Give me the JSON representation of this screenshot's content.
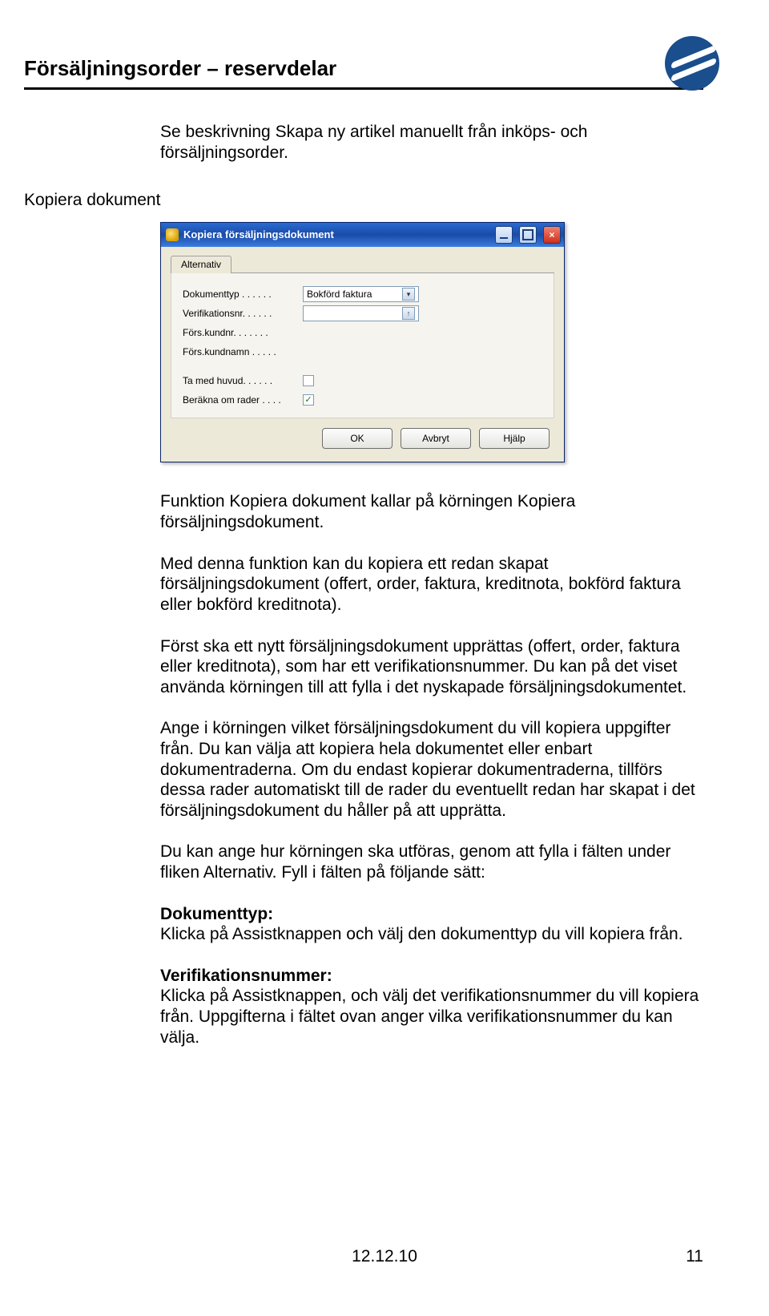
{
  "header": {
    "title": "Försäljningsorder – reservdelar"
  },
  "logo": {
    "name": "company-logo"
  },
  "intro": "Se beskrivning Skapa ny artikel manuellt från inköps- och försäljningsorder.",
  "section_label": "Kopiera dokument",
  "dialog": {
    "title": "Kopiera försäljningsdokument",
    "tab": "Alternativ",
    "fields": {
      "dokumenttyp_label": "Dokumenttyp . . . . . .",
      "dokumenttyp_value": "Bokförd faktura",
      "verifikationsnr_label": "Verifikationsnr. . . . . .",
      "verifikationsnr_value": "",
      "forskundnr_label": "Förs.kundnr. . . . . . .",
      "forskundnamn_label": "Förs.kundnamn . . . . .",
      "tamedhuvud_label": "Ta med huvud. . . . . .",
      "tamedhuvud_checked": false,
      "beraknaom_label": "Beräkna om rader . . . .",
      "beraknaom_checked": true
    },
    "buttons": {
      "ok": "OK",
      "cancel": "Avbryt",
      "help": "Hjälp"
    }
  },
  "body": {
    "p1": "Funktion Kopiera dokument kallar på körningen Kopiera försäljningsdokument.",
    "p2": "Med denna funktion kan du kopiera ett redan skapat försäljningsdokument (offert, order, faktura, kreditnota, bokförd faktura eller bokförd kreditnota).",
    "p3": "Först ska ett nytt försäljningsdokument upprättas (offert, order, faktura eller kreditnota), som har ett verifikationsnummer. Du kan på det viset använda körningen till att fylla i det nyskapade försäljningsdokumentet.",
    "p4": "Ange i körningen vilket försäljningsdokument du vill kopiera uppgifter från. Du kan välja att kopiera hela dokumentet eller enbart dokumentraderna. Om du endast kopierar dokumentraderna, tillförs dessa rader automatiskt till de rader du eventuellt redan har skapat i det försäljningsdokument du håller på att upprätta.",
    "p5": "Du kan ange hur körningen ska utföras, genom att fylla i fälten under fliken Alternativ. Fyll i fälten på följande sätt:",
    "h1": "Dokumenttyp:",
    "p6": "Klicka på Assistknappen och välj den dokumenttyp du vill kopiera från.",
    "h2": "Verifikationsnummer:",
    "p7": "Klicka på Assistknappen, och välj det verifikationsnummer du vill kopiera från. Uppgifterna i fältet ovan anger vilka verifikationsnummer du kan välja."
  },
  "footer": {
    "date": "12.12.10",
    "page": "11"
  }
}
